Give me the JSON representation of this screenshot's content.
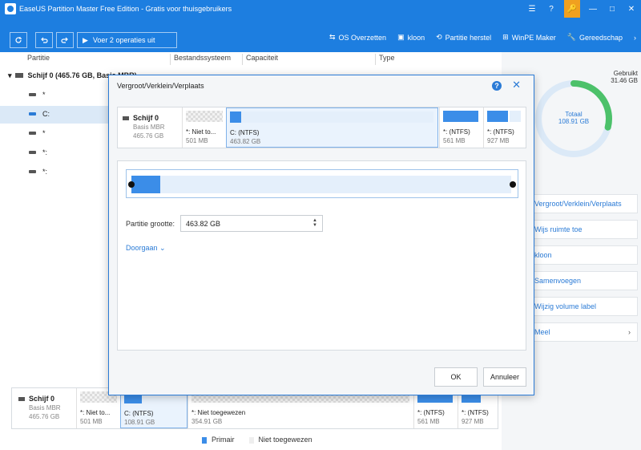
{
  "window": {
    "title": "EaseUS Partition Master Free Edition - Gratis voor thuisgebruikers",
    "controls": [
      "☰",
      "?",
      "🔑",
      "—",
      "□",
      "✕"
    ]
  },
  "toolbar": {
    "refresh_icon": "refresh-icon",
    "undo_icon": "undo-icon",
    "redo_icon": "redo-icon",
    "apply_label": "Voer 2 operaties uit",
    "items": [
      {
        "label": "OS Overzetten",
        "icon": "os-migrate-icon",
        "glyph": "⇆"
      },
      {
        "label": "kloon",
        "icon": "clone-icon",
        "glyph": "▣"
      },
      {
        "label": "Partitie herstel",
        "icon": "partition-recovery-icon",
        "glyph": "⟲"
      },
      {
        "label": "WinPE Maker",
        "icon": "winpe-icon",
        "glyph": "⊞"
      },
      {
        "label": "Gereedschap",
        "icon": "tools-icon",
        "glyph": "🔧"
      }
    ],
    "more": "›"
  },
  "table": {
    "headers": [
      "Partitie",
      "Bestandssysteem",
      "Capaciteit",
      "Type"
    ],
    "rows": [
      {
        "label": "Schijf 0 (465.76 GB, Basis MBR)",
        "kind": "disk"
      },
      {
        "label": "*"
      },
      {
        "label": "C:",
        "selected": true
      },
      {
        "label": "*"
      },
      {
        "label": "*:"
      },
      {
        "label": "*:"
      }
    ]
  },
  "bottom_disk": {
    "name": "Schijf 0",
    "type": "Basis MBR",
    "size": "465.76 GB",
    "segments": [
      {
        "label": "*: Niet to...",
        "size": "501 MB"
      },
      {
        "label": "C: (NTFS)",
        "size": "108.91 GB"
      },
      {
        "label": "*: Niet toegewezen",
        "size": "354.91 GB"
      },
      {
        "label": "*: (NTFS)",
        "size": "561 MB"
      },
      {
        "label": "*: (NTFS)",
        "size": "927 MB"
      }
    ]
  },
  "legend": {
    "primary": "Primair",
    "unallocated": "Niet toegewezen"
  },
  "usage": {
    "used_label": "Gebruikt",
    "used_value": "31.46 GB",
    "total_label": "Totaal",
    "total_value": "108.91 GB",
    "used_fraction": 0.289,
    "accent": "#4cc16a",
    "track": "#dbe9f7"
  },
  "actions": [
    {
      "label": "Vergroot/Verklein/Verplaats"
    },
    {
      "label": "Wijs ruimte toe"
    },
    {
      "label": "kloon"
    },
    {
      "label": "Samenvoegen"
    },
    {
      "label": "Wijzig volume label"
    },
    {
      "label": "Meel",
      "chevron": "›"
    }
  ],
  "dialog": {
    "title": "Vergroot/Verklein/Verplaats",
    "help": "?",
    "close": "✕",
    "disk": {
      "name": "Schijf 0",
      "type": "Basis MBR",
      "size": "465.76 GB",
      "segments": [
        {
          "label": "*: Niet to...",
          "size": "501 MB"
        },
        {
          "label": "C: (NTFS)",
          "size": "463.82 GB"
        },
        {
          "label": "*: (NTFS)",
          "size": "561 MB"
        },
        {
          "label": "*: (NTFS)",
          "size": "927 MB"
        }
      ]
    },
    "partition_size_label": "Partitie grootte:",
    "partition_size_value": "463.82 GB",
    "advanced_label": "Doorgaan ⌄",
    "ok_label": "OK",
    "cancel_label": "Annuleer"
  },
  "colors": {
    "brand": "#1d7ee0",
    "primary_partition": "#3b8de8"
  }
}
